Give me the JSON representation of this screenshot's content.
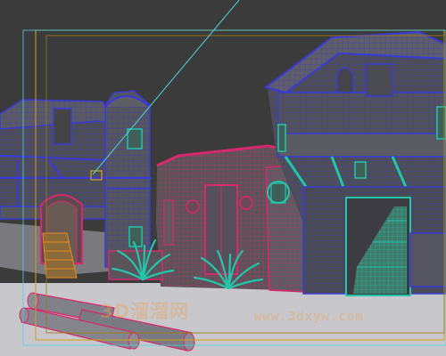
{
  "viewport": {
    "background_color": "#3b3b3b",
    "ground_color": "#c8c8cc",
    "wire_blue": "#3a3ad8",
    "wire_magenta": "#d8286c",
    "wire_teal": "#22c6a8",
    "wire_orange": "#e88a22",
    "safe_frame_color": "#d4a017",
    "camera_line_color": "#4ad4e0"
  },
  "watermark": {
    "chinese": "3D溜溜网",
    "url": "www.3dxyw.com"
  }
}
